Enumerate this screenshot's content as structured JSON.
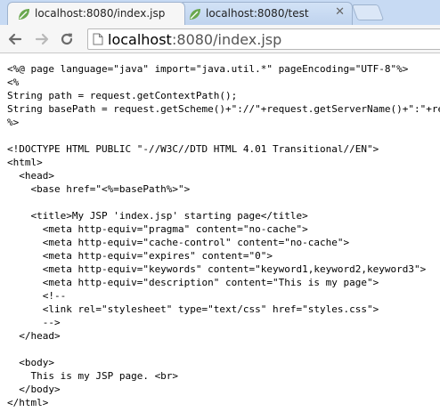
{
  "tabs": [
    {
      "title": "localhost:8080/index.jsp",
      "active": true,
      "icon": "leaf-icon"
    },
    {
      "title": "localhost:8080/test",
      "active": false,
      "icon": "leaf-icon"
    }
  ],
  "toolbar": {
    "back_icon": "back-arrow-icon",
    "forward_icon": "forward-arrow-icon",
    "reload_icon": "reload-icon",
    "url_host": "localhost",
    "url_path": ":8080/index.jsp"
  },
  "colors": {
    "tabstrip": "#c7daf3",
    "leaf_icon": "#6aa84f"
  },
  "source_lines": [
    "<%@ page language=\"java\" import=\"java.util.*\" pageEncoding=\"UTF-8\"%>",
    "<%",
    "String path = request.getContextPath();",
    "String basePath = request.getScheme()+\"://\"+request.getServerName()+\":\"+request.getServerPort()+path+\"/\";",
    "%>",
    "",
    "<!DOCTYPE HTML PUBLIC \"-//W3C//DTD HTML 4.01 Transitional//EN\">",
    "<html>",
    "  <head>",
    "    <base href=\"<%=basePath%>\">",
    "",
    "    <title>My JSP 'index.jsp' starting page</title>",
    "      <meta http-equiv=\"pragma\" content=\"no-cache\">",
    "      <meta http-equiv=\"cache-control\" content=\"no-cache\">",
    "      <meta http-equiv=\"expires\" content=\"0\">",
    "      <meta http-equiv=\"keywords\" content=\"keyword1,keyword2,keyword3\">",
    "      <meta http-equiv=\"description\" content=\"This is my page\">",
    "      <!--",
    "      <link rel=\"stylesheet\" type=\"text/css\" href=\"styles.css\">",
    "      -->",
    "  </head>",
    "",
    "  <body>",
    "    This is my JSP page. <br>",
    "  </body>",
    "</html>"
  ]
}
